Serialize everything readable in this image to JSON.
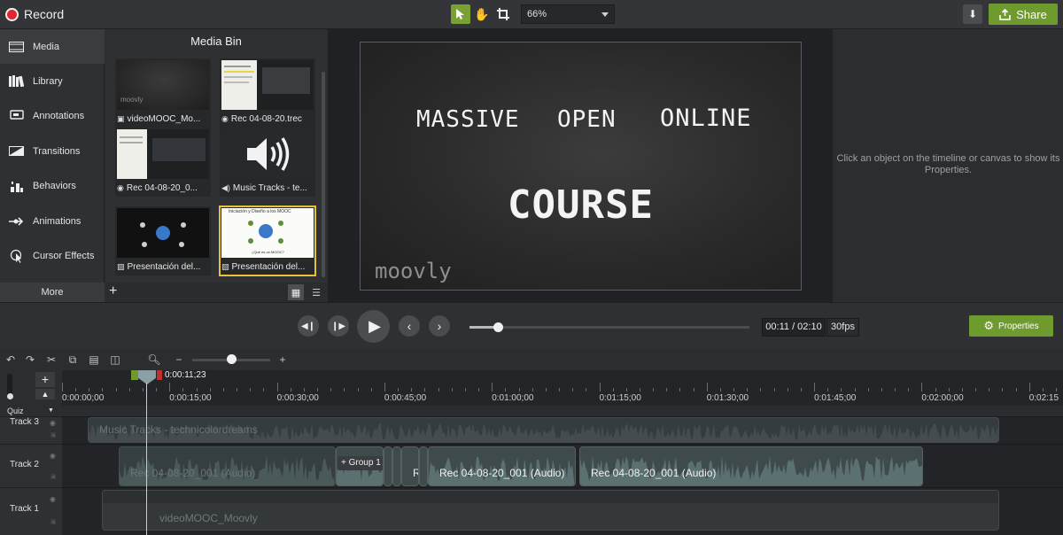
{
  "app": {
    "record_label": "Record",
    "share_label": "Share",
    "zoom_value": "66%"
  },
  "sidebar": {
    "items": [
      {
        "label": "Media",
        "icon": "film-strip-icon"
      },
      {
        "label": "Library",
        "icon": "library-books-icon"
      },
      {
        "label": "Annotations",
        "icon": "annotation-bubble-icon"
      },
      {
        "label": "Transitions",
        "icon": "transition-icon"
      },
      {
        "label": "Behaviors",
        "icon": "behaviors-icon"
      },
      {
        "label": "Animations",
        "icon": "animation-arrow-icon"
      },
      {
        "label": "Cursor Effects",
        "icon": "cursor-effects-icon"
      }
    ],
    "more_label": "More"
  },
  "media_bin": {
    "title": "Media Bin",
    "items": [
      {
        "caption": "videoMOOC_Mo...",
        "thumb_text": "moovly"
      },
      {
        "caption": "Rec 04-08-20.trec"
      },
      {
        "caption": "Rec 04-08-20_0..."
      },
      {
        "caption": "Music Tracks - te..."
      },
      {
        "caption": "Presentación del..."
      },
      {
        "caption": "Presentación del...",
        "thumb_title": "Iniciación y Diseño a los MOOC",
        "thumb_sub": "¿Qué es un MOOC?"
      }
    ]
  },
  "canvas": {
    "word1": "MASSIVE",
    "word2": "OPEN",
    "word3": "ONLINE",
    "word4": "COURSE",
    "brand": "moovly"
  },
  "properties": {
    "hint": "Click an object on the timeline or canvas to show its Properties.",
    "button_label": "Properties"
  },
  "playback": {
    "time": "00:11 / 02:10",
    "fps": "30fps",
    "progress": 0.1
  },
  "timeline": {
    "playhead_time": "0:00:11;23",
    "zoom_level": 0.5,
    "ruler_labels": [
      "0:00:00;00",
      "0:00:15;00",
      "0:00:30;00",
      "0:00:45;00",
      "0:01:00;00",
      "0:01:15;00",
      "0:01:30;00",
      "0:01:45;00",
      "0:02:00;00",
      "0:02:15"
    ],
    "quiz_label": "Quiz",
    "tracks": [
      {
        "name": "Track 3",
        "clips": [
          {
            "label": "Music Tracks - technicolordreams"
          }
        ]
      },
      {
        "name": "Track 2",
        "clips": [
          {
            "label": "Rec 04-08-20_001 (Audio)"
          },
          {
            "label": "Group 1"
          },
          {
            "label": "R"
          },
          {
            "label": "Rec 04-08-20_001 (Audio)"
          },
          {
            "label": "Rec 04-08-20_001 (Audio)"
          }
        ]
      },
      {
        "name": "Track 1",
        "clips": [
          {
            "label": "videoMOOC_Moovly"
          }
        ]
      }
    ]
  },
  "colors": {
    "accent_green": "#6f9a2e",
    "record_red": "#e0262e",
    "selection_yellow": "#e8c13a"
  }
}
